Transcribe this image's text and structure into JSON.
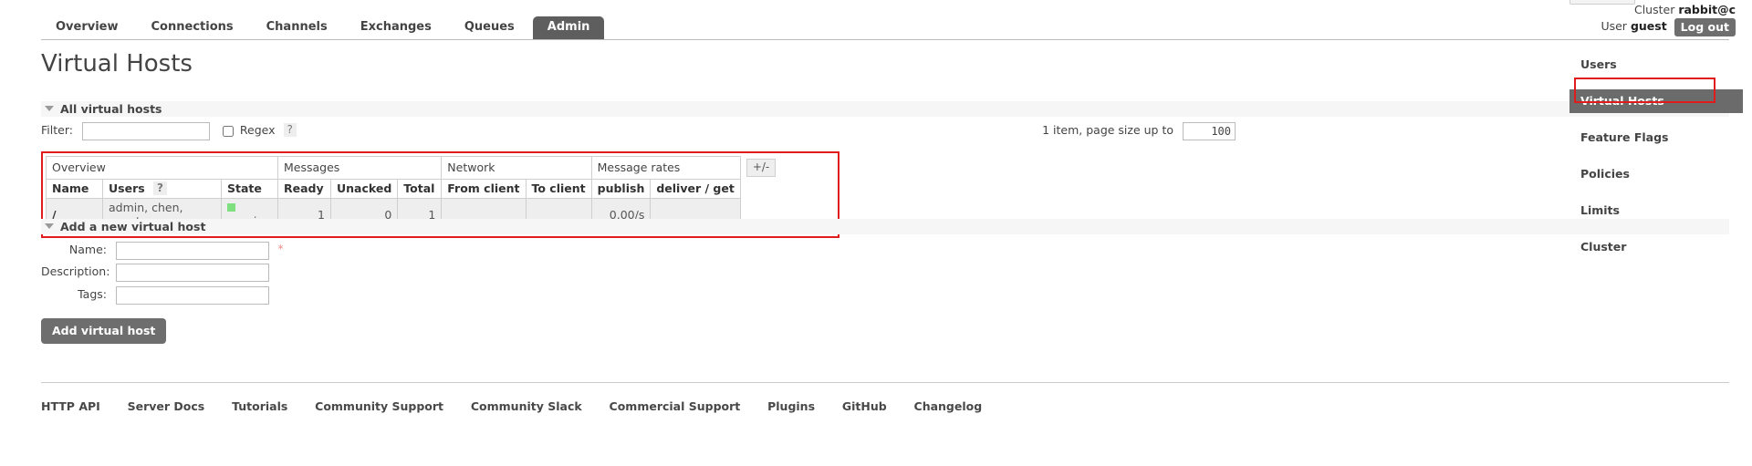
{
  "status": {
    "cluster_label": "Cluster",
    "cluster_name": "rabbit@c",
    "user_label": "User",
    "user_name": "guest",
    "logout_label": "Log out"
  },
  "nav": {
    "tabs": [
      {
        "label": "Overview",
        "selected": false
      },
      {
        "label": "Connections",
        "selected": false
      },
      {
        "label": "Channels",
        "selected": false
      },
      {
        "label": "Exchanges",
        "selected": false
      },
      {
        "label": "Queues",
        "selected": false
      },
      {
        "label": "Admin",
        "selected": true
      }
    ]
  },
  "page": {
    "title": "Virtual Hosts"
  },
  "sections": {
    "all_vhosts": "All virtual hosts",
    "add_vhost": "Add a new virtual host"
  },
  "filter": {
    "label": "Filter:",
    "value": "",
    "placeholder": "",
    "regex_label": "Regex",
    "help": "?"
  },
  "paging": {
    "summary": "1 item, page size up to",
    "page_size": "100"
  },
  "table": {
    "group_headers": {
      "overview": "Overview",
      "messages": "Messages",
      "network": "Network",
      "message_rates": "Message rates",
      "toggle": "+/-"
    },
    "columns": {
      "name": "Name",
      "users": "Users",
      "users_help": "?",
      "state": "State",
      "ready": "Ready",
      "unacked": "Unacked",
      "total": "Total",
      "from_client": "From client",
      "to_client": "To client",
      "publish": "publish",
      "deliver_get": "deliver / get"
    },
    "rows": [
      {
        "name": "/",
        "users": "admin, chen, guest",
        "state": "running",
        "ready": "1",
        "unacked": "0",
        "total": "1",
        "from_client": "",
        "to_client": "",
        "publish": "0.00/s",
        "deliver_get": ""
      }
    ]
  },
  "add_form": {
    "name_label": "Name:",
    "name_value": "",
    "required_mark": "*",
    "description_label": "Description:",
    "description_value": "",
    "tags_label": "Tags:",
    "tags_value": "",
    "submit_label": "Add virtual host"
  },
  "footer": {
    "links": [
      "HTTP API",
      "Server Docs",
      "Tutorials",
      "Community Support",
      "Community Slack",
      "Commercial Support",
      "Plugins",
      "GitHub",
      "Changelog"
    ]
  },
  "sidebar": {
    "items": [
      {
        "label": "Users",
        "selected": false
      },
      {
        "label": "Virtual Hosts",
        "selected": true
      },
      {
        "label": "Feature Flags",
        "selected": false
      },
      {
        "label": "Policies",
        "selected": false
      },
      {
        "label": "Limits",
        "selected": false
      },
      {
        "label": "Cluster",
        "selected": false
      }
    ]
  },
  "colors": {
    "accent_selected": "#6b6b6b",
    "highlight_box": "#e01b1b",
    "status_running": "#80e080"
  }
}
